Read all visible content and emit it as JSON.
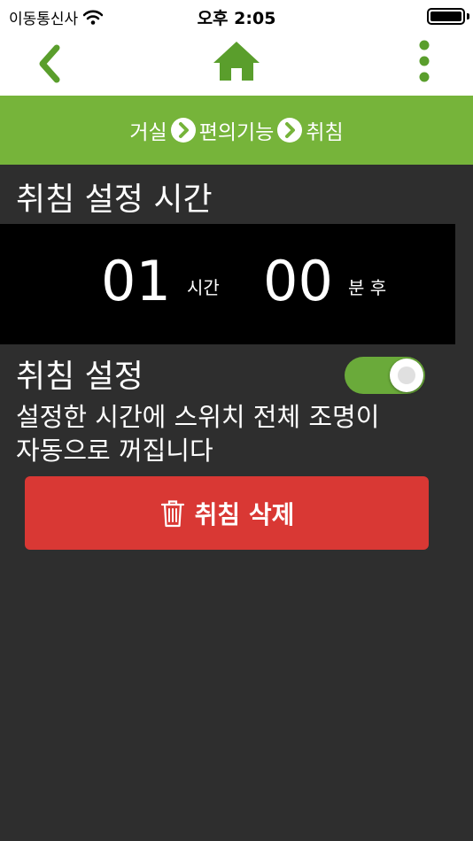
{
  "status_bar": {
    "carrier": "이동통신사",
    "time": "오후 2:05",
    "wifi_icon": "wifi-icon",
    "battery_icon": "battery-icon"
  },
  "nav": {
    "back_icon": "chevron-left-icon",
    "home_icon": "home-icon",
    "more_icon": "more-vertical-icon",
    "accent_color": "#5a9e2c"
  },
  "breadcrumb": {
    "items": [
      "거실",
      "편의기능",
      "취침"
    ],
    "separator_icon": "chevron-right-circle-icon",
    "background": "#76b43a"
  },
  "sleep_time": {
    "title": "취침 설정 시간",
    "hours": "01",
    "hours_unit": "시간",
    "minutes": "00",
    "minutes_unit": "분 후"
  },
  "sleep_setting": {
    "title": "취침 설정",
    "enabled": true,
    "description_line1": "설정한 시간에 스위치 전체 조명이",
    "description_line2": "자동으로 꺼집니다"
  },
  "delete_button": {
    "label": "취침 삭제",
    "icon": "trash-icon",
    "color": "#d93834"
  }
}
